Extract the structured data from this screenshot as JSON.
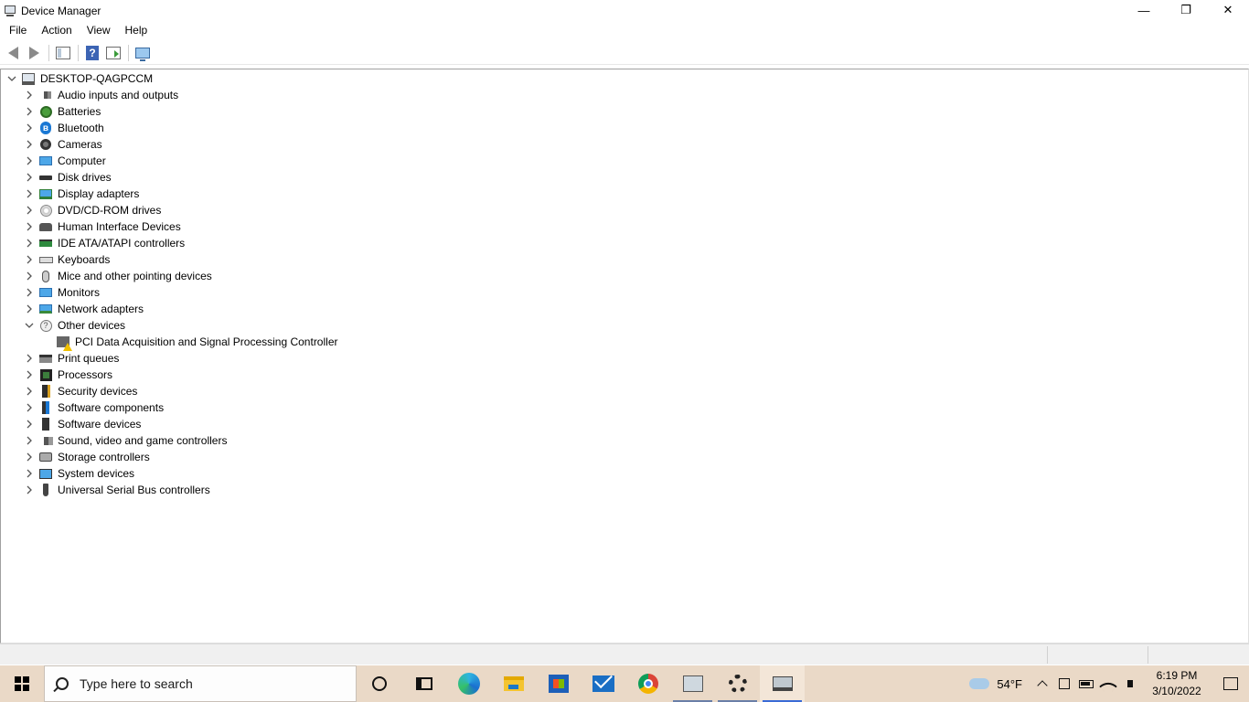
{
  "window": {
    "title": "Device Manager",
    "minimize_glyph": "—",
    "maximize_glyph": "❐",
    "close_glyph": "✕"
  },
  "menu": [
    "File",
    "Action",
    "View",
    "Help"
  ],
  "toolbar": {
    "buttons": [
      "back-arrow-icon",
      "forward-arrow-icon",
      "properties-icon",
      "help-icon",
      "update-driver-icon",
      "scan-hardware-icon"
    ],
    "help_glyph": "?"
  },
  "tree": {
    "root": "DESKTOP-QAGPCCM",
    "categories": [
      {
        "label": "Audio inputs and outputs",
        "icon": "speaker-icon",
        "expanded": false
      },
      {
        "label": "Batteries",
        "icon": "battery-icon",
        "expanded": false
      },
      {
        "label": "Bluetooth",
        "icon": "bluetooth-icon",
        "expanded": false
      },
      {
        "label": "Cameras",
        "icon": "camera-icon",
        "expanded": false
      },
      {
        "label": "Computer",
        "icon": "computer-icon",
        "expanded": false
      },
      {
        "label": "Disk drives",
        "icon": "disk-drive-icon",
        "expanded": false
      },
      {
        "label": "Display adapters",
        "icon": "display-adapter-icon",
        "expanded": false
      },
      {
        "label": "DVD/CD-ROM drives",
        "icon": "dvd-icon",
        "expanded": false
      },
      {
        "label": "Human Interface Devices",
        "icon": "hid-icon",
        "expanded": false
      },
      {
        "label": "IDE ATA/ATAPI controllers",
        "icon": "ide-controller-icon",
        "expanded": false
      },
      {
        "label": "Keyboards",
        "icon": "keyboard-icon",
        "expanded": false
      },
      {
        "label": "Mice and other pointing devices",
        "icon": "mouse-icon",
        "expanded": false
      },
      {
        "label": "Monitors",
        "icon": "monitor-icon",
        "expanded": false
      },
      {
        "label": "Network adapters",
        "icon": "network-adapter-icon",
        "expanded": false
      },
      {
        "label": "Other devices",
        "icon": "other-devices-icon",
        "expanded": true,
        "children": [
          {
            "label": "PCI Data Acquisition and Signal Processing Controller",
            "icon": "pci-device-warning-icon"
          }
        ]
      },
      {
        "label": "Print queues",
        "icon": "printer-icon",
        "expanded": false
      },
      {
        "label": "Processors",
        "icon": "processor-icon",
        "expanded": false
      },
      {
        "label": "Security devices",
        "icon": "security-device-icon",
        "expanded": false
      },
      {
        "label": "Software components",
        "icon": "software-component-icon",
        "expanded": false
      },
      {
        "label": "Software devices",
        "icon": "software-device-icon",
        "expanded": false
      },
      {
        "label": "Sound, video and game controllers",
        "icon": "sound-controller-icon",
        "expanded": false
      },
      {
        "label": "Storage controllers",
        "icon": "storage-controller-icon",
        "expanded": false
      },
      {
        "label": "System devices",
        "icon": "system-device-icon",
        "expanded": false
      },
      {
        "label": "Universal Serial Bus controllers",
        "icon": "usb-icon",
        "expanded": false
      }
    ]
  },
  "taskbar": {
    "search_placeholder": "Type here to search",
    "apps": [
      "cortana-icon",
      "task-view-icon",
      "edge-icon",
      "file-explorer-icon",
      "store-icon",
      "mail-icon",
      "chrome-icon",
      "remote-desktop-icon",
      "settings-icon",
      "device-manager-icon"
    ],
    "weather": "54°F",
    "time": "6:19 PM",
    "date": "3/10/2022"
  },
  "colors": {
    "taskbar": "#ead9c7",
    "accent": "#3a6bd6"
  }
}
